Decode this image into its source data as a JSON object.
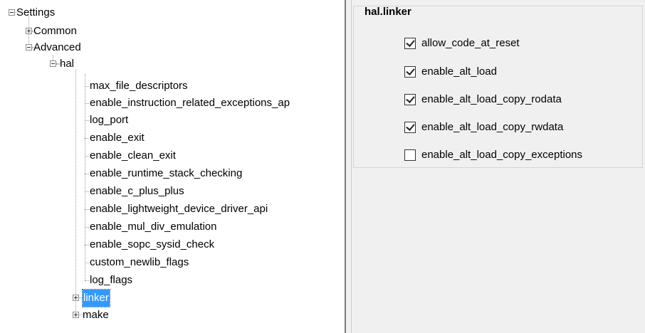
{
  "tree": {
    "root": "Settings",
    "common": "Common",
    "advanced": "Advanced",
    "hal": "hal",
    "hal_children": [
      "max_file_descriptors",
      "enable_instruction_related_exceptions_ap",
      "log_port",
      "enable_exit",
      "enable_clean_exit",
      "enable_runtime_stack_checking",
      "enable_c_plus_plus",
      "enable_lightweight_device_driver_api",
      "enable_mul_div_emulation",
      "enable_sopc_sysid_check",
      "custom_newlib_flags",
      "log_flags"
    ],
    "linker": "linker",
    "make": "make"
  },
  "panel": {
    "title": "hal.linker",
    "options": [
      {
        "label": "allow_code_at_reset",
        "checked": true
      },
      {
        "label": "enable_alt_load",
        "checked": true
      },
      {
        "label": "enable_alt_load_copy_rodata",
        "checked": true
      },
      {
        "label": "enable_alt_load_copy_rwdata",
        "checked": true
      },
      {
        "label": "enable_alt_load_copy_exceptions",
        "checked": false
      }
    ]
  },
  "colors": {
    "selection": "#3399ff",
    "pane_background": "#f0f0f0"
  }
}
